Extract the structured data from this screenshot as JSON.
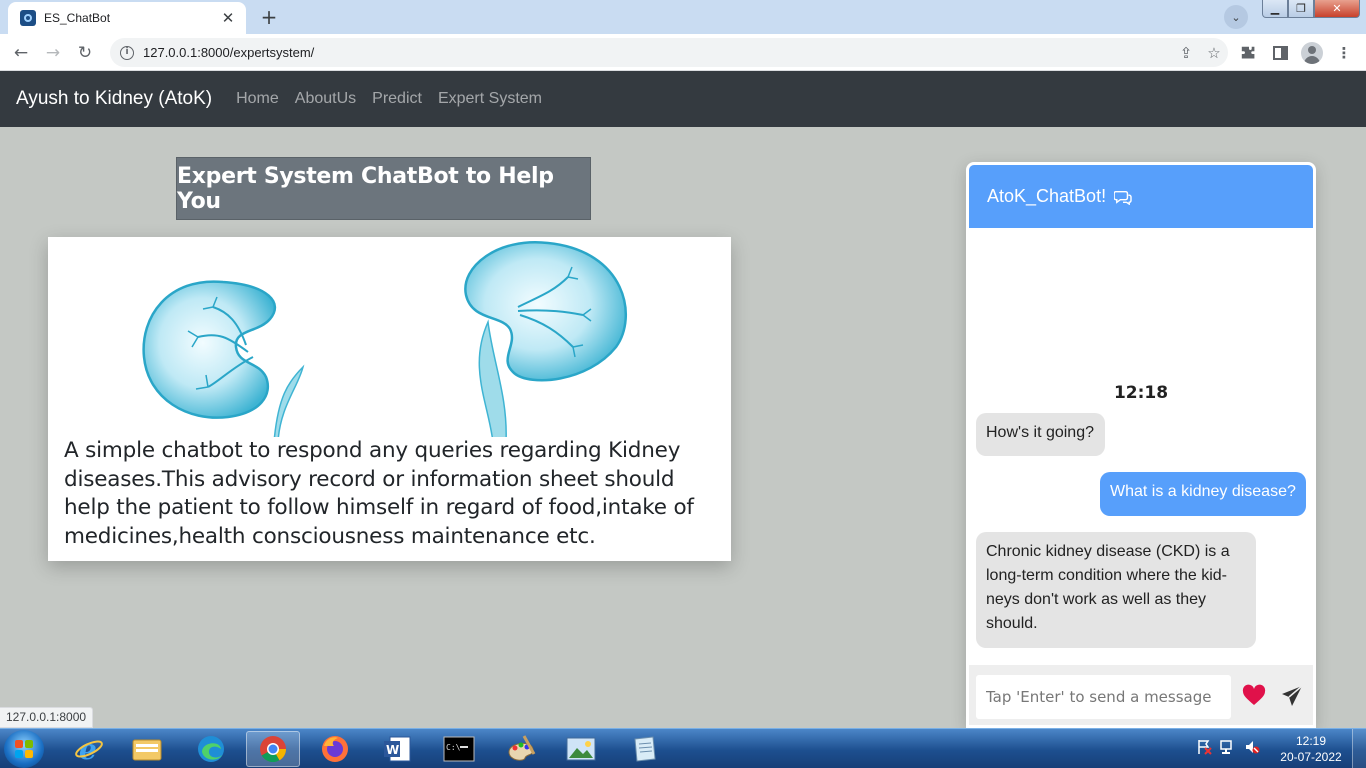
{
  "browser": {
    "tab_title": "ES_ChatBot",
    "url": "127.0.0.1:8000/expertsystem/",
    "status_link": "127.0.0.1:8000"
  },
  "site": {
    "brand": "Ayush to Kidney (AtoK)",
    "nav": [
      {
        "label": "Home"
      },
      {
        "label": "AboutUs"
      },
      {
        "label": "Predict"
      },
      {
        "label": "Expert System"
      }
    ]
  },
  "main": {
    "title": "Expert System ChatBot to Help You",
    "description": "A simple chatbot to respond any queries regarding Kidney diseases.This advisory record or information sheet should help the patient to follow himself in regard of food,intake of medicines,health consciousness maintenance etc.",
    "image_icon": "kidney-illustration"
  },
  "chat": {
    "title": "AtoK_ChatBot!",
    "title_icon": "comments-icon",
    "time": "12:18",
    "messages": [
      {
        "side": "bot",
        "text": "How's it going?"
      },
      {
        "side": "user",
        "text": "What is a kidney disease?"
      },
      {
        "side": "bot",
        "text": "Chronic kidney disease (CKD) is a long-term condition where the kid-neys don't work as well as they should."
      }
    ],
    "input_placeholder": "Tap 'Enter' to send a message",
    "heart_color": "#e0114a",
    "accent_color": "#579ffb"
  },
  "taskbar": {
    "apps": [
      "internet-explorer",
      "file-explorer",
      "microsoft-edge",
      "google-chrome",
      "firefox",
      "microsoft-word",
      "command-prompt",
      "paint",
      "photo-viewer",
      "notepad"
    ],
    "clock_time": "12:19",
    "clock_date": "20-07-2022"
  }
}
